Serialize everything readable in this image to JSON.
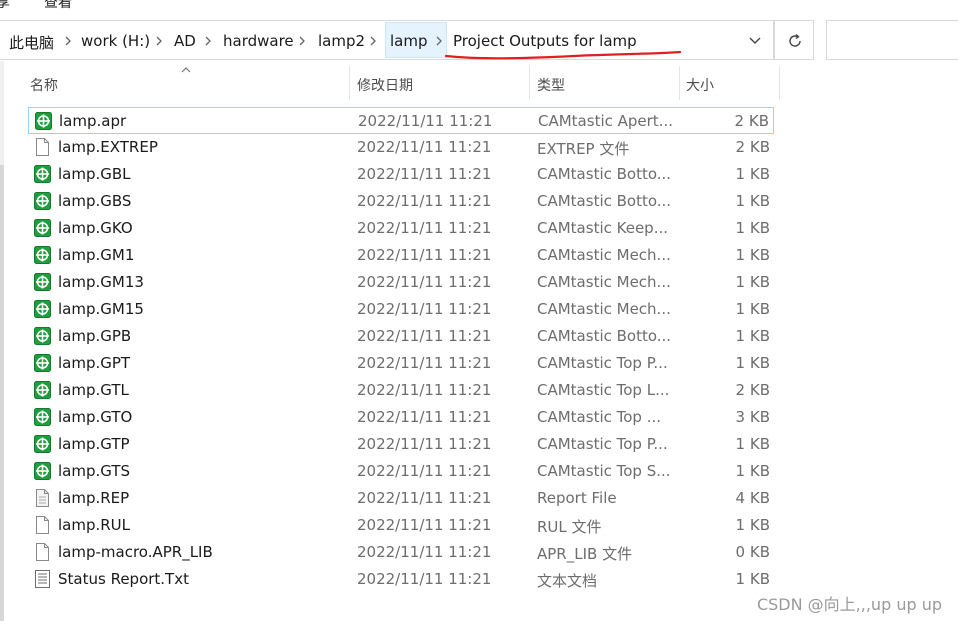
{
  "ribbon": {
    "item1": "享",
    "item2": "查看"
  },
  "breadcrumb": {
    "items": [
      "此电脑",
      "work (H:)",
      "AD",
      "hardware",
      "lamp2",
      "lamp",
      "Project Outputs for lamp"
    ]
  },
  "columns": {
    "name": "名称",
    "date": "修改日期",
    "type": "类型",
    "size": "大小"
  },
  "files": [
    {
      "name": "lamp.apr",
      "date": "2022/11/11 11:21",
      "type": "CAMtastic Apert...",
      "size": "2 KB",
      "icon": "cam-icon"
    },
    {
      "name": "lamp.EXTREP",
      "date": "2022/11/11 11:21",
      "type": "EXTREP 文件",
      "size": "2 KB",
      "icon": "file-icon"
    },
    {
      "name": "lamp.GBL",
      "date": "2022/11/11 11:21",
      "type": "CAMtastic Botto...",
      "size": "1 KB",
      "icon": "cam-icon"
    },
    {
      "name": "lamp.GBS",
      "date": "2022/11/11 11:21",
      "type": "CAMtastic Botto...",
      "size": "1 KB",
      "icon": "cam-icon"
    },
    {
      "name": "lamp.GKO",
      "date": "2022/11/11 11:21",
      "type": "CAMtastic Keep...",
      "size": "1 KB",
      "icon": "cam-icon"
    },
    {
      "name": "lamp.GM1",
      "date": "2022/11/11 11:21",
      "type": "CAMtastic Mech...",
      "size": "1 KB",
      "icon": "cam-icon"
    },
    {
      "name": "lamp.GM13",
      "date": "2022/11/11 11:21",
      "type": "CAMtastic Mech...",
      "size": "1 KB",
      "icon": "cam-icon"
    },
    {
      "name": "lamp.GM15",
      "date": "2022/11/11 11:21",
      "type": "CAMtastic Mech...",
      "size": "1 KB",
      "icon": "cam-icon"
    },
    {
      "name": "lamp.GPB",
      "date": "2022/11/11 11:21",
      "type": "CAMtastic Botto...",
      "size": "1 KB",
      "icon": "cam-icon"
    },
    {
      "name": "lamp.GPT",
      "date": "2022/11/11 11:21",
      "type": "CAMtastic Top P...",
      "size": "1 KB",
      "icon": "cam-icon"
    },
    {
      "name": "lamp.GTL",
      "date": "2022/11/11 11:21",
      "type": "CAMtastic Top L...",
      "size": "2 KB",
      "icon": "cam-icon"
    },
    {
      "name": "lamp.GTO",
      "date": "2022/11/11 11:21",
      "type": "CAMtastic Top ...",
      "size": "3 KB",
      "icon": "cam-icon"
    },
    {
      "name": "lamp.GTP",
      "date": "2022/11/11 11:21",
      "type": "CAMtastic Top P...",
      "size": "1 KB",
      "icon": "cam-icon"
    },
    {
      "name": "lamp.GTS",
      "date": "2022/11/11 11:21",
      "type": "CAMtastic Top S...",
      "size": "1 KB",
      "icon": "cam-icon"
    },
    {
      "name": "lamp.REP",
      "date": "2022/11/11 11:21",
      "type": "Report File",
      "size": "4 KB",
      "icon": "report-file-icon"
    },
    {
      "name": "lamp.RUL",
      "date": "2022/11/11 11:21",
      "type": "RUL 文件",
      "size": "1 KB",
      "icon": "file-icon"
    },
    {
      "name": "lamp-macro.APR_LIB",
      "date": "2022/11/11 11:21",
      "type": "APR_LIB 文件",
      "size": "0 KB",
      "icon": "file-icon"
    },
    {
      "name": "Status Report.Txt",
      "date": "2022/11/11 11:21",
      "type": "文本文档",
      "size": "1 KB",
      "icon": "text-doc-icon"
    }
  ],
  "watermark": "CSDN @向上,,,up up up",
  "colors": {
    "cam_green": "#1e9e3e",
    "selection_border": "#99d1ff",
    "annotation_red": "#e02020"
  }
}
